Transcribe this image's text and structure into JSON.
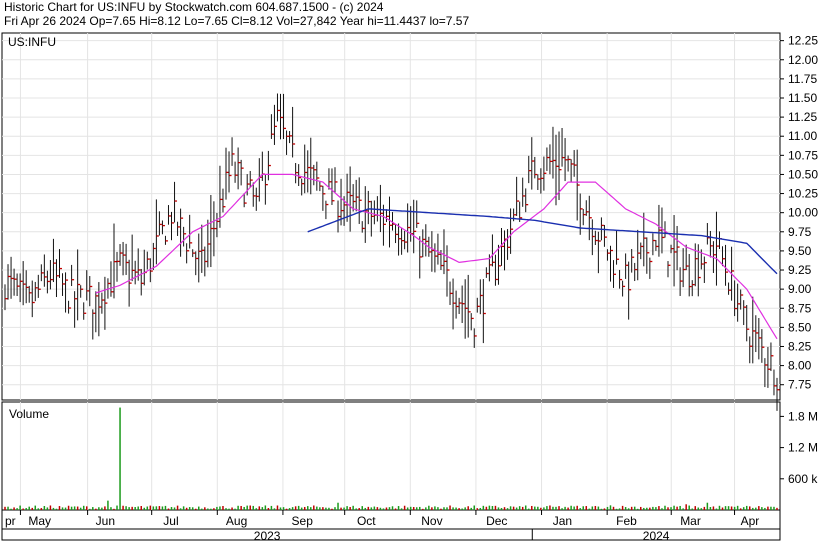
{
  "header": {
    "line1": "Historic Chart for US:INFU by Stockwatch.com 604.687.1500 - (c) 2024",
    "line2": "Fri Apr 26 2024   Op=7.65   Hi=8.12   Lo=7.65   Cl=8.12   Vol=27,842   Year hi=11.4437   lo=7.57"
  },
  "chart_data": [
    {
      "type": "ohlc",
      "ticker_label": "US:INFU",
      "y_ticks": [
        "12.25",
        "12.00",
        "11.75",
        "11.50",
        "11.25",
        "11.00",
        "10.75",
        "10.50",
        "10.25",
        "10.00",
        "9.75",
        "9.50",
        "9.25",
        "9.00",
        "8.75",
        "8.50",
        "8.25",
        "8.00",
        "7.75"
      ],
      "ylim": [
        7.55,
        12.35
      ],
      "x_months": [
        "pr",
        "May",
        "Jun",
        "Jul",
        "Aug",
        "Sep",
        "Oct",
        "Nov",
        "Dec",
        "Jan",
        "Feb",
        "Mar",
        "Apr"
      ],
      "x_years": [
        "2023",
        "2024"
      ],
      "close_anchors": {
        "x_index": [
          0,
          8,
          15,
          22,
          30,
          38,
          45,
          55,
          65,
          75,
          83,
          90,
          95,
          100,
          108,
          118,
          128,
          135,
          145,
          155,
          165,
          175,
          185,
          195,
          205,
          215,
          225,
          235,
          245,
          255
        ],
        "values": [
          9.1,
          8.8,
          9.2,
          8.9,
          8.85,
          9.3,
          9.1,
          10.0,
          9.3,
          10.6,
          10.1,
          11.2,
          10.7,
          10.5,
          10.2,
          10.0,
          9.9,
          9.7,
          9.2,
          8.6,
          9.6,
          10.6,
          10.7,
          9.8,
          9.1,
          9.7,
          9.2,
          9.6,
          8.5,
          7.9
        ]
      },
      "ma_short": {
        "x_index": [
          30,
          38,
          50,
          62,
          72,
          85,
          95,
          105,
          115,
          125,
          135,
          140,
          150,
          160,
          168,
          178,
          186,
          195,
          205,
          215,
          225,
          235,
          245,
          255
        ],
        "values": [
          8.95,
          9.05,
          9.3,
          9.75,
          9.95,
          10.5,
          10.5,
          10.4,
          10.05,
          9.95,
          9.7,
          9.55,
          9.35,
          9.4,
          9.75,
          10.05,
          10.4,
          10.4,
          10.05,
          9.85,
          9.55,
          9.4,
          9.0,
          8.35
        ]
      },
      "ma_long": {
        "x_index": [
          100,
          120,
          140,
          160,
          175,
          190,
          210,
          230,
          245,
          255
        ],
        "values": [
          9.75,
          10.05,
          10.0,
          9.95,
          9.9,
          9.8,
          9.75,
          9.7,
          9.6,
          9.2
        ]
      },
      "volume": {
        "label": "Volume",
        "y_ticks": [
          "1.8 M",
          "1.2 M",
          "600 k"
        ],
        "ylim": [
          0,
          2000000
        ],
        "typical": 55000,
        "spikes": {
          "x_index": [
            38,
            34,
            110,
            200,
            225,
            232
          ],
          "values": [
            1970000,
            180000,
            140000,
            90000,
            110000,
            140000
          ]
        }
      }
    }
  ]
}
